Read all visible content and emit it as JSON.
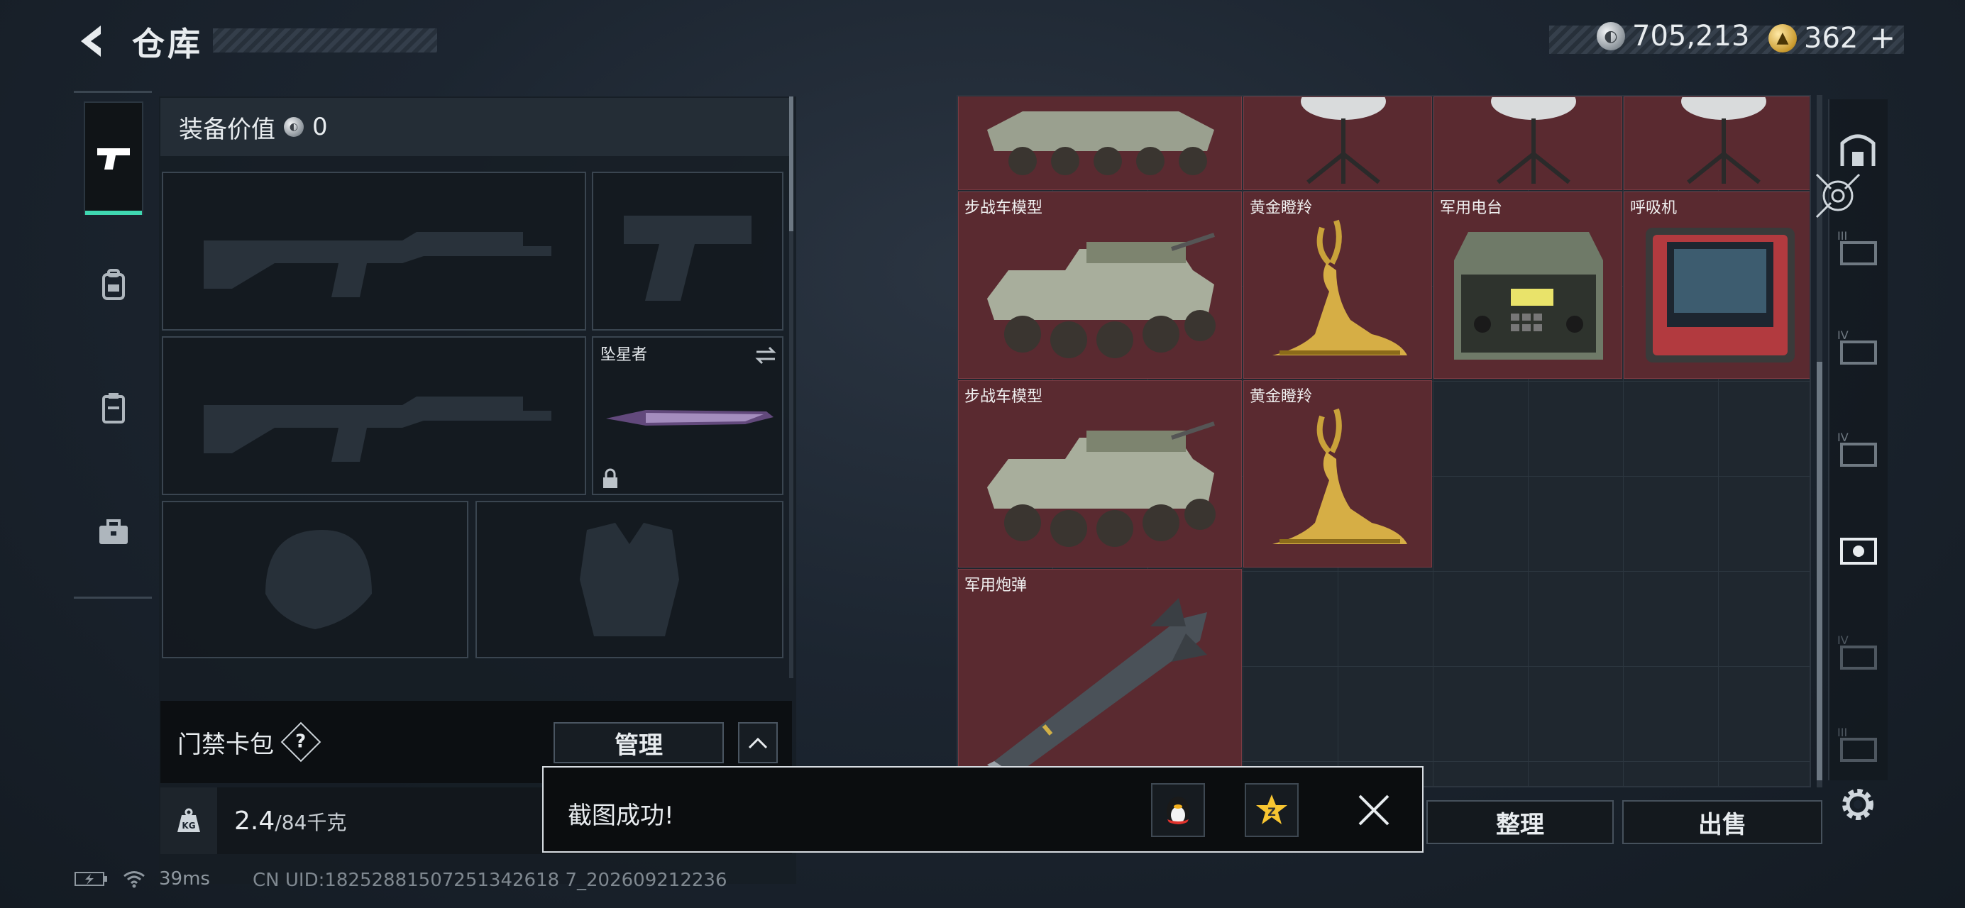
{
  "header": {
    "title": "仓库",
    "back_icon": "chevron-left-icon",
    "currencies": [
      {
        "icon": "silver-coin-icon",
        "value": "705,213"
      },
      {
        "icon": "gold-coin-icon",
        "value": "362",
        "add_label": "+"
      }
    ]
  },
  "left_rail": {
    "items": [
      {
        "icon": "pistol-icon",
        "active": true
      },
      {
        "icon": "backpack-icon",
        "active": false
      },
      {
        "icon": "clipboard-icon",
        "active": false
      },
      {
        "icon": "toolbox-icon",
        "active": false
      }
    ]
  },
  "equipment": {
    "header_label": "装备价值",
    "header_value": "0",
    "melee_slot": {
      "label": "坠星者",
      "swap_icon": "swap-arrows-icon",
      "lock_icon": "lock-icon"
    },
    "keycard": {
      "label": "门禁卡包",
      "help": "?",
      "manage_label": "管理",
      "collapse_icon": "chevron-up-icon"
    },
    "weight": {
      "value": "2.4",
      "capacity": "/84千克",
      "icon": "kg-weight-icon"
    }
  },
  "storage": {
    "items": [
      {
        "name": "",
        "type": "vehicle"
      },
      {
        "name": "",
        "type": "dish"
      },
      {
        "name": "",
        "type": "dish"
      },
      {
        "name": "",
        "type": "dish"
      },
      {
        "name": "步战车模型",
        "type": "vehicle"
      },
      {
        "name": "黄金瞪羚",
        "type": "gazelle"
      },
      {
        "name": "军用电台",
        "type": "radio"
      },
      {
        "name": "呼吸机",
        "type": "ventilator"
      },
      {
        "name": "步战车模型",
        "type": "vehicle"
      },
      {
        "name": "黄金瞪羚",
        "type": "gazelle"
      },
      {
        "name": "军用炮弹",
        "type": "shell"
      }
    ],
    "actions": {
      "sort": "整理",
      "sell": "出售"
    }
  },
  "toast": {
    "message": "截图成功!",
    "share_icons": [
      "qq-penguin-icon",
      "star-badge-icon"
    ],
    "close_icon": "close-icon"
  },
  "status_bar": {
    "ping": "39ms",
    "uid": "CN UID:18252881507251342618 7_202609212236"
  },
  "colors": {
    "accent": "#3fd7b1",
    "item_bg": "#5a2a30",
    "panel_bg": "#1b2229"
  }
}
